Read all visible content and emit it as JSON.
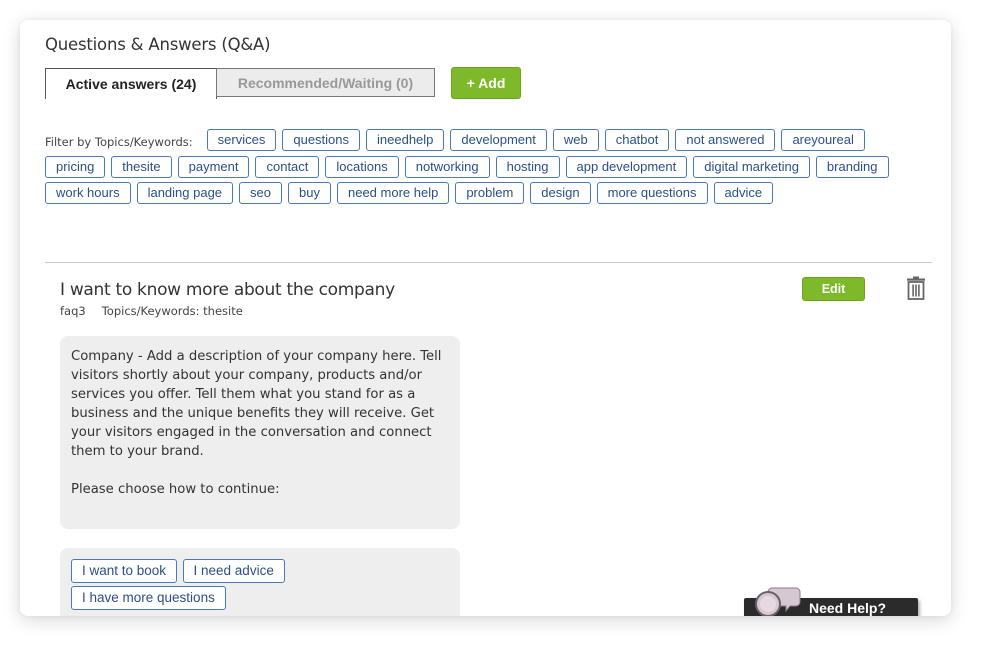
{
  "page": {
    "title": "Questions & Answers (Q&A)"
  },
  "tabs": [
    {
      "label": "Active answers (24)",
      "active": true
    },
    {
      "label": "Recommended/Waiting (0)",
      "active": false
    }
  ],
  "toolbar": {
    "add_label": "+ Add"
  },
  "filters": {
    "label": "Filter by Topics/Keywords:",
    "chips": [
      "services",
      "questions",
      "ineedhelp",
      "development",
      "web",
      "chatbot",
      "not answered",
      "areyoureal",
      "pricing",
      "thesite",
      "payment",
      "contact",
      "locations",
      "notworking",
      "hosting",
      "app development",
      "digital marketing",
      "branding",
      "work hours",
      "landing page",
      "seo",
      "buy",
      "need more help",
      "problem",
      "design",
      "more questions",
      "advice"
    ]
  },
  "question": {
    "title": "I want to know more about the company",
    "id": "faq3",
    "topics": "Topics/Keywords: thesite",
    "edit_label": "Edit",
    "answer_paragraphs": [
      "Company - Add a description of your company here. Tell visitors shortly about your company, products and/or services you offer. Tell them what you stand for as a business and the unique benefits they will receive. Get your visitors engaged in the conversation and connect them to your brand.",
      "Please choose how to continue:"
    ],
    "choices": [
      "I want to book",
      "I need advice",
      "I have more questions"
    ]
  },
  "help_widget": {
    "label": "Need Help?"
  },
  "colors": {
    "accent_green": "#7eb92a",
    "chip_border": "#4a78b8",
    "chip_text": "#2c4f86"
  }
}
